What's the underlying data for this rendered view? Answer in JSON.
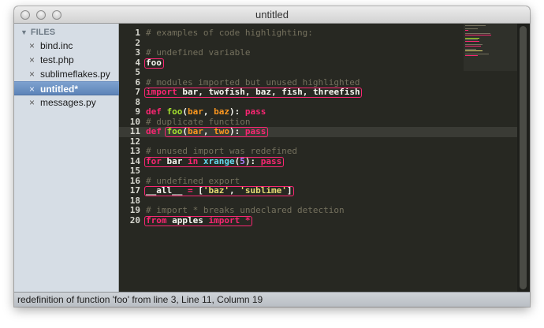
{
  "window": {
    "title": "untitled"
  },
  "sidebar": {
    "header": "FILES",
    "files": [
      {
        "name": "bind.inc",
        "selected": false
      },
      {
        "name": "test.php",
        "selected": false
      },
      {
        "name": "sublimeflakes.py",
        "selected": false
      },
      {
        "name": "untitled*",
        "selected": true
      },
      {
        "name": "messages.py",
        "selected": false
      }
    ]
  },
  "editor": {
    "current_line": 11,
    "theme_colors": {
      "background": "#272822",
      "comment": "#75715e",
      "keyword": "#f92672",
      "function": "#a6e22e",
      "parameter": "#fd971f",
      "builtin": "#66d9ef",
      "number": "#ae81ff",
      "string": "#e6db74",
      "error_outline": "#f92672"
    },
    "lines": [
      {
        "num": "1",
        "text": "# examples of code highlighting:"
      },
      {
        "num": "2",
        "text": ""
      },
      {
        "num": "3",
        "text": "# undefined variable"
      },
      {
        "num": "4",
        "text": "foo"
      },
      {
        "num": "5",
        "text": ""
      },
      {
        "num": "6",
        "text": "# modules imported but unused highlighted"
      },
      {
        "num": "7",
        "text": "import bar, twofish, baz, fish, threefish"
      },
      {
        "num": "8",
        "text": ""
      },
      {
        "num": "9",
        "text": "def foo(bar, baz): pass"
      },
      {
        "num": "10",
        "text": "# duplicate function"
      },
      {
        "num": "11",
        "text": "def foo(bar, two): pass"
      },
      {
        "num": "12",
        "text": ""
      },
      {
        "num": "13",
        "text": "# unused import was redefined"
      },
      {
        "num": "14",
        "text": "for bar in xrange(5): pass"
      },
      {
        "num": "15",
        "text": ""
      },
      {
        "num": "16",
        "text": "# undefined export"
      },
      {
        "num": "17",
        "text": "__all__ = ['baz', 'sublime']"
      },
      {
        "num": "18",
        "text": ""
      },
      {
        "num": "19",
        "text": "# import * breaks undeclared detection"
      },
      {
        "num": "20",
        "text": "from apples import *"
      }
    ]
  },
  "statusbar": {
    "text": "redefinition of function 'foo' from line 3, Line 11, Column 19"
  }
}
